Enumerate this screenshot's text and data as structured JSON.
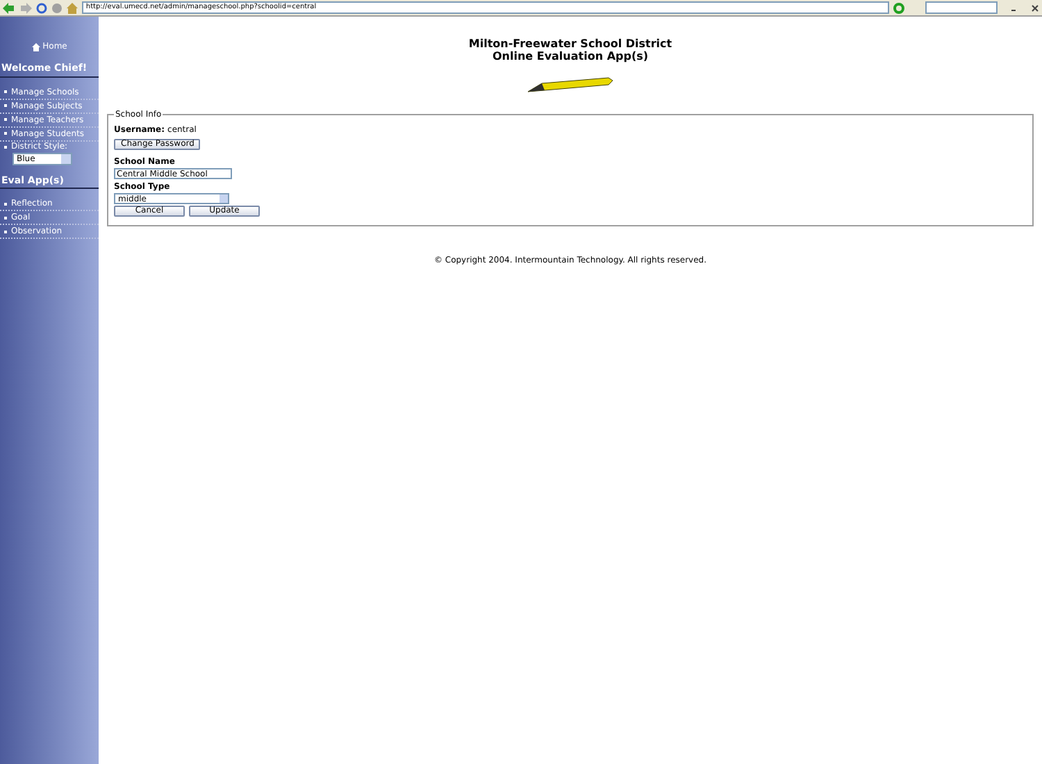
{
  "browser": {
    "address": "http://eval.umecd.net/admin/manageschool.php?schoolid=central"
  },
  "sidebar": {
    "home": "Home",
    "welcome": "Welcome Chief!",
    "items": [
      {
        "label": "Manage Schools"
      },
      {
        "label": "Manage Subjects"
      },
      {
        "label": "Manage Teachers"
      },
      {
        "label": "Manage Students"
      }
    ],
    "style_label": "District Style:",
    "style_value": "Blue",
    "apps_heading": "Eval App(s)",
    "apps": [
      {
        "label": "Reflection"
      },
      {
        "label": "Goal"
      },
      {
        "label": "Observation"
      }
    ]
  },
  "header": {
    "line1": "Milton-Freewater School District",
    "line2": "Online Evaluation App(s)"
  },
  "form": {
    "legend": "School Info",
    "username_label": "Username:",
    "username": "central",
    "change_password": "Change Password",
    "name_label": "School Name",
    "name_value": "Central Middle School",
    "type_label": "School Type",
    "type_value": "middle",
    "buttons": [
      "Cancel",
      "Update"
    ]
  },
  "footer": "© Copyright 2004. Intermountain Technology. All rights reserved."
}
